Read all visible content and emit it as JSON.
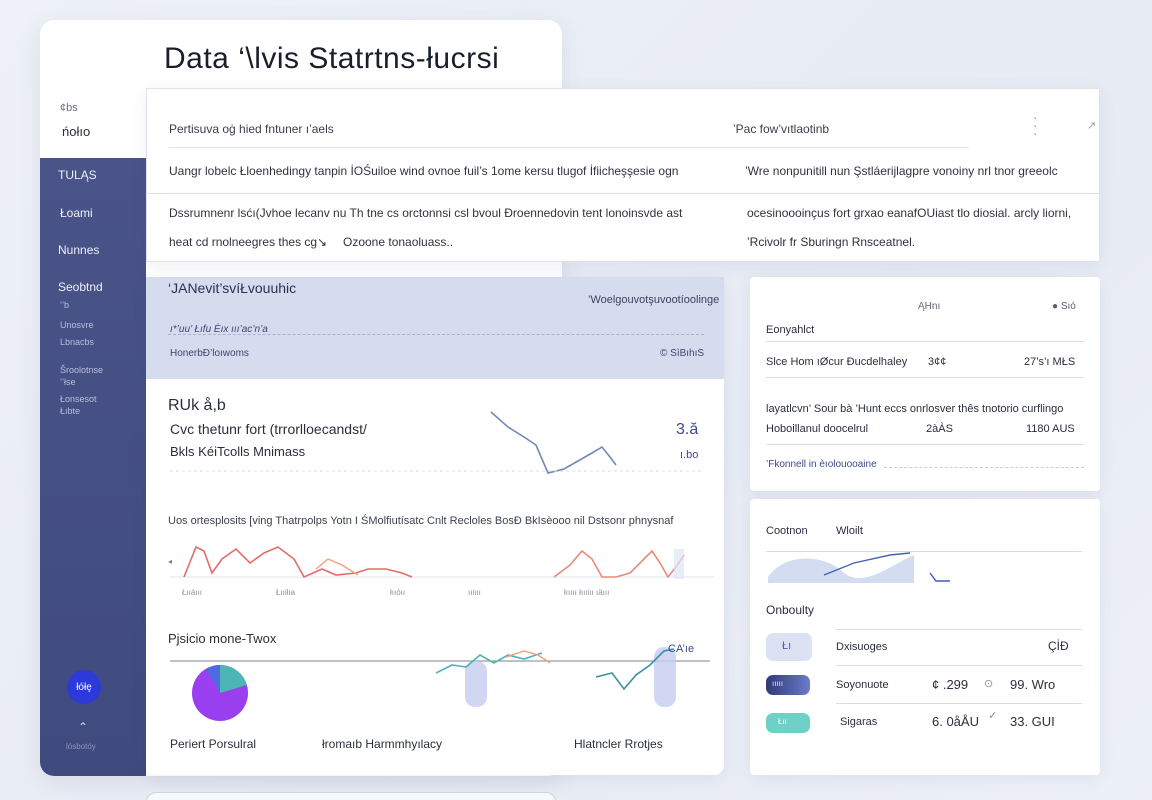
{
  "app": {
    "title": "Data ‘\\lvis  Statrtns-łucrsi",
    "meta_label": "¢bs",
    "meta_value": "ńołıo"
  },
  "sidebar": {
    "items": [
      {
        "label": "TULĄS"
      },
      {
        "label": "Łoami"
      },
      {
        "label": "Nunnes"
      },
      {
        "label": "Seobtnd"
      }
    ],
    "sub_items": [
      "‘’b",
      "Unosvre",
      "Lbnacbs",
      "Šroolotnse",
      "‘’łse",
      "Łonsesot",
      "Łıbte"
    ],
    "avatar_label": "łółę",
    "footer": "lósbotóy"
  },
  "top_panel": {
    "col1_header": "Pertisuva oġ hied fntuner ı’aels",
    "col2_header": "’Pac fow’vıtlaotinb",
    "row1_col1": "Uangr lobelc Łloenhedingy tanpin İOŚuiloe wind ovnoe fuil’s 1ome kersu tlugof İfiicheşşesie ogn",
    "row1_col2": "’Wre nonpunitill nun Şstláerĳlagpre vonoiny nrl tnor greeolc",
    "row2_col1": "Dssrumnenr lsćı(Jvhoe lecanv nu Th tne cs orctonnsi csl bvoul Ðroennedovin tent lonoinsvde ast",
    "row2_col2": "ocesinoooinçus fort grxao eanafOUiast tlo diosial. arcly liorni,",
    "row3_col1": "heat cd rnolneegres thes cg",
    "row3_col1b": "Ozoone tonaoluass..",
    "row3_col2": "’Rcivolr fr Sburingn Rnsceatnel."
  },
  "center": {
    "band": {
      "title": "‘JANevit’svíŁvouuhic",
      "right_label": "’Woelgouvotşuvootíoolinge",
      "sub1": "ı*’uu’ Łıfu Èıx ııı’ac’n’a",
      "sub2": "HonerbÐ’loıwoms",
      "sub3": "© SìBıhıS"
    },
    "kpi": {
      "title": "RUk å,b",
      "line1": "Cvc thetunr fort (trrorlloecandst/",
      "line2": "Bkls  KéiTcolls  Mnimass",
      "value": "3.ă",
      "sub_value": "ı.bo"
    },
    "section2_title": "Uos ortesplosits [ving Thatrpolps Yotn I ŚMolfiutísatc Cnlt Recloles BosÐ BkIsèooo nil Dstsonr phnysnaf",
    "chart2_labels": [
      "Łııáııı",
      "Łııiłıa",
      "łııóıı",
      "ııiııı",
      "łııııı łıııiıı ıäııı"
    ],
    "section3_title": "Pjsicio mone-Twox",
    "section3_corner": "CA’ıе",
    "bottom_labels": [
      "Periert Porsulral",
      "łromaıb Harmmhyılacy",
      "Hlatncler Rrotjes"
    ]
  },
  "right_panel_1": {
    "col_a": "ĄHnı",
    "col_b": "● Sıó",
    "section": "Eonyahlct",
    "row1_label": "Slce Hom ıØcur Ðucdelhaley",
    "row1_mid": "3¢¢",
    "row1_val": "27’s’ı MŁS",
    "para": "layatlcvn’ Sour bà ’Hunt eccs onrlosver thês tnotorio curflingo",
    "row2_label": "Hoboillanul doocelrul",
    "row2_mid": "2àÀS",
    "row2_val": "1180 AUS",
    "footer": "’Fkonnell in èıolouooaine"
  },
  "right_panel_2": {
    "col_a": "Cootnon",
    "col_b": "Wloilt",
    "section": "Onboulty",
    "rows": [
      {
        "pill": "Łı",
        "label": "Dxisuoges",
        "val1": "",
        "val2": "ÇİÐ"
      },
      {
        "pill": "ııııı",
        "label": "Soyonuote",
        "val1": "¢ .299",
        "val2": "99. Wro"
      },
      {
        "pill": "Łıı",
        "label": "Sigaras",
        "val1": "6. 0åÅU",
        "val2": "33. GUI"
      }
    ]
  },
  "colors": {
    "sidebar": "#4a5488",
    "accent_blue": "#3d5a9c",
    "coral": "#e86a6a",
    "teal": "#4bb8b8",
    "purple": "#8f4fe8"
  }
}
